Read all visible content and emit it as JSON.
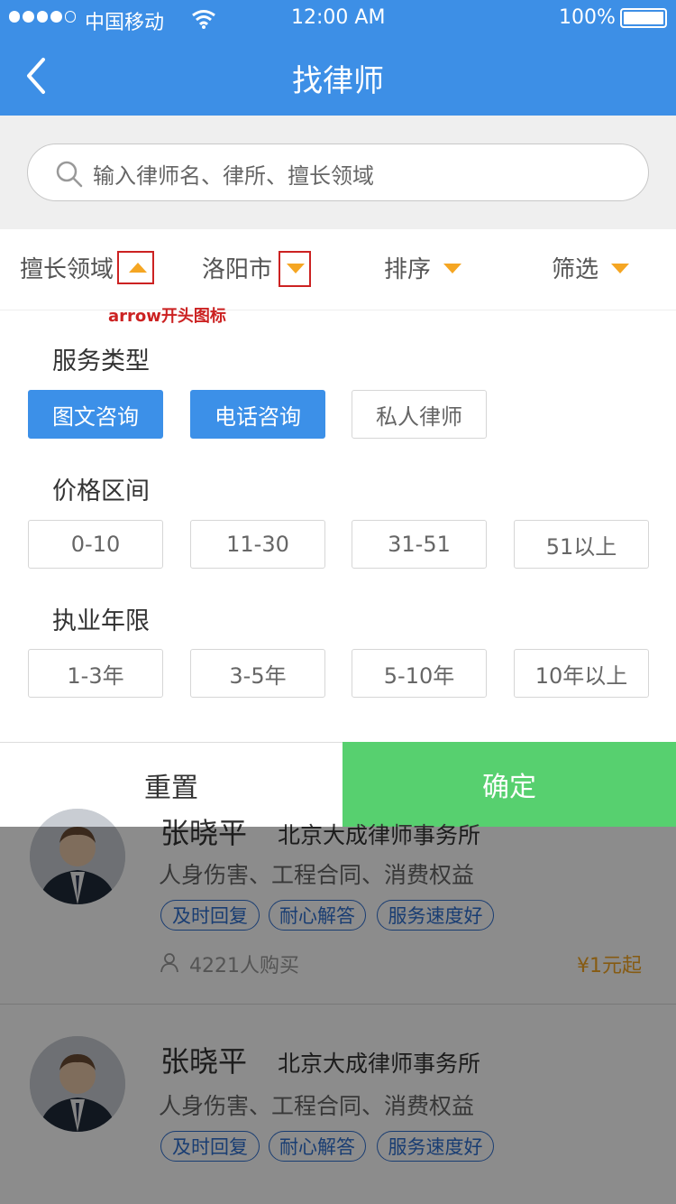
{
  "status_bar": {
    "carrier": "中国移动",
    "time": "12:00 AM",
    "battery": "100%",
    "signal_dots": 5
  },
  "nav": {
    "title": "找律师",
    "back_icon": "chevron-left-icon"
  },
  "search": {
    "placeholder": "输入律师名、律所、擅长领域",
    "icon": "search-icon"
  },
  "filters": [
    {
      "label": "擅长领域",
      "arrow": "up",
      "active": true
    },
    {
      "label": "洛阳市",
      "arrow": "down",
      "active": false
    },
    {
      "label": "排序",
      "arrow": "down",
      "active": false
    },
    {
      "label": "筛选",
      "arrow": "down",
      "active": false
    }
  ],
  "annotation": {
    "text": "arrow开头图标"
  },
  "panel": {
    "service": {
      "title": "服务类型",
      "options": [
        "图文咨询",
        "电话咨询",
        "私人律师"
      ],
      "selected": [
        0,
        1
      ]
    },
    "price": {
      "title": "价格区间",
      "options": [
        "0-10",
        "11-30",
        "31-51",
        "51以上"
      ]
    },
    "years": {
      "title": "执业年限",
      "options": [
        "1-3年",
        "3-5年",
        "5-10年",
        "10年以上"
      ]
    }
  },
  "actions": {
    "reset": "重置",
    "confirm": "确定"
  },
  "lawyers": [
    {
      "name": "张晓平",
      "firm": "北京大成律师事务所",
      "areas": "人身伤害、工程合同、消费权益",
      "tags": [
        "及时回复",
        "耐心解答",
        "服务速度好"
      ],
      "buyers": "4221人购买",
      "price": "¥1元起"
    },
    {
      "name": "张晓平",
      "firm": "北京大成律师事务所",
      "areas": "人身伤害、工程合同、消费权益",
      "tags": [
        "及时回复",
        "耐心解答",
        "服务速度好"
      ]
    }
  ],
  "colors": {
    "primary": "#3d8fe6",
    "confirm": "#57d06f",
    "arrow": "#f5a623",
    "annotation": "#cc2222",
    "tag": "#2f6fd0",
    "price": "#f5a623"
  }
}
